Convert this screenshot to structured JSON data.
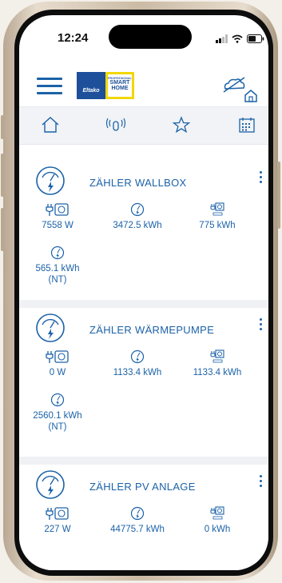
{
  "status": {
    "time": "12:24"
  },
  "colors": {
    "accent": "#1c62a8",
    "logo_blue": "#1d4f9a",
    "logo_yellow": "#f2d700"
  },
  "logo": {
    "brand": "Eltako",
    "line1": "PROFESSIONAL",
    "line2": "SMART",
    "line3": "HOME"
  },
  "tabs": [
    "home-icon",
    "sensor-icon",
    "star-icon",
    "calendar-icon"
  ],
  "cards": [
    {
      "title": "ZÄHLER WALLBOX",
      "metrics": [
        {
          "icon": "plug-meter-icon",
          "value": "7558 W"
        },
        {
          "icon": "gauge-icon",
          "value": "3472.5 kWh"
        },
        {
          "icon": "meter-box-icon",
          "value": "775 kWh"
        },
        {
          "icon": "gauge-icon",
          "value": "565.1 kWh\n(NT)"
        }
      ]
    },
    {
      "title": "ZÄHLER WÄRMEPUMPE",
      "metrics": [
        {
          "icon": "plug-meter-icon",
          "value": "0 W"
        },
        {
          "icon": "gauge-icon",
          "value": "1133.4 kWh"
        },
        {
          "icon": "meter-box-icon",
          "value": "1133.4 kWh"
        },
        {
          "icon": "gauge-icon",
          "value": "2560.1 kWh\n(NT)"
        }
      ]
    },
    {
      "title": "ZÄHLER PV ANLAGE",
      "metrics": [
        {
          "icon": "plug-meter-icon",
          "value": "227 W"
        },
        {
          "icon": "gauge-icon",
          "value": "44775.7 kWh"
        },
        {
          "icon": "meter-box-icon",
          "value": "0 kWh"
        }
      ]
    }
  ]
}
